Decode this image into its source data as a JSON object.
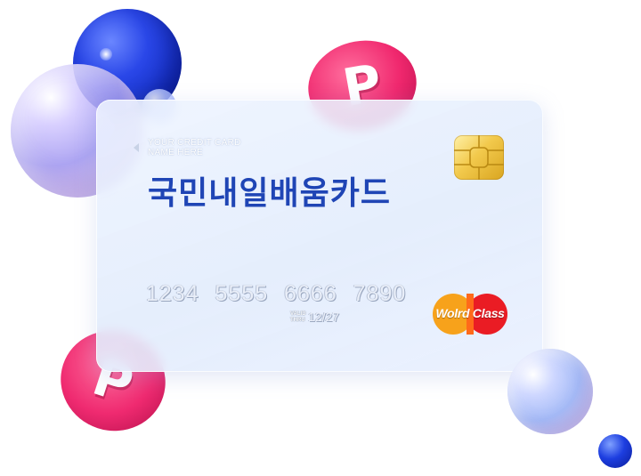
{
  "card": {
    "holder_line1": "YOUR CREDIT CARD",
    "holder_line2": "NAME HERE",
    "title": "국민내일배움카드",
    "number": "1234 5555 6666 7890",
    "valid_line1": "VALID",
    "valid_line2": "THRU",
    "expiry": "12/27",
    "brand": "Wolrd Class"
  },
  "coin_letter": "P",
  "colors": {
    "title": "#1f45b5",
    "coin": "#f0286e",
    "brand_left": "#f7a21b",
    "brand_right": "#ea1c24",
    "chip": "#f2c94c"
  }
}
